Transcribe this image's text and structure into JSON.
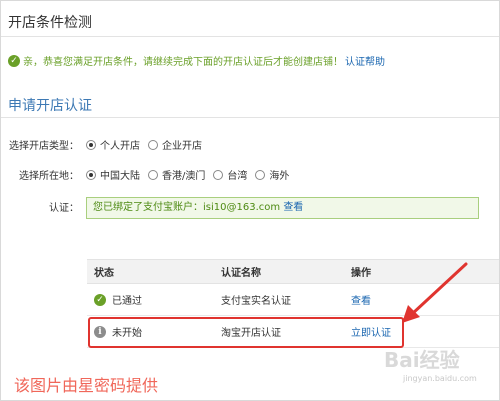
{
  "page": {
    "title": "开店条件检测",
    "notice": "亲，恭喜您满足开店条件，请继续完成下面的开店认证后才能创建店铺！",
    "help_link": "认证帮助",
    "section_title": "申请开店认证"
  },
  "form": {
    "shop_type": {
      "label": "选择开店类型：",
      "options": [
        "个人开店",
        "企业开店"
      ],
      "selected": "个人开店"
    },
    "location": {
      "label": "选择所在地：",
      "options": [
        "中国大陆",
        "香港/澳门",
        "台湾",
        "海外"
      ],
      "selected": "中国大陆"
    },
    "certification": {
      "label": "认证：",
      "text": "您已绑定了支付宝账户：isi10@163.com",
      "view_link": "查看"
    }
  },
  "table": {
    "headers": [
      "状态",
      "认证名称",
      "操作"
    ],
    "rows": [
      {
        "status": "已通过",
        "status_icon": "check-icon",
        "name": "支付宝实名认证",
        "action": "查看"
      },
      {
        "status": "未开始",
        "status_icon": "info-icon",
        "name": "淘宝开店认证",
        "action": "立即认证"
      }
    ]
  },
  "annotation": {
    "watermark": "该图片由星密码提供",
    "highlight_color": "#e0342f"
  },
  "brand": {
    "logo": "Bai经验",
    "site": "jingyan.baidu.com"
  },
  "colors": {
    "success": "#6aa028",
    "link": "#1a66b0",
    "section_title": "#3d79b4",
    "cert_border": "#a9cf7e",
    "cert_bg": "#f1f8e8"
  }
}
